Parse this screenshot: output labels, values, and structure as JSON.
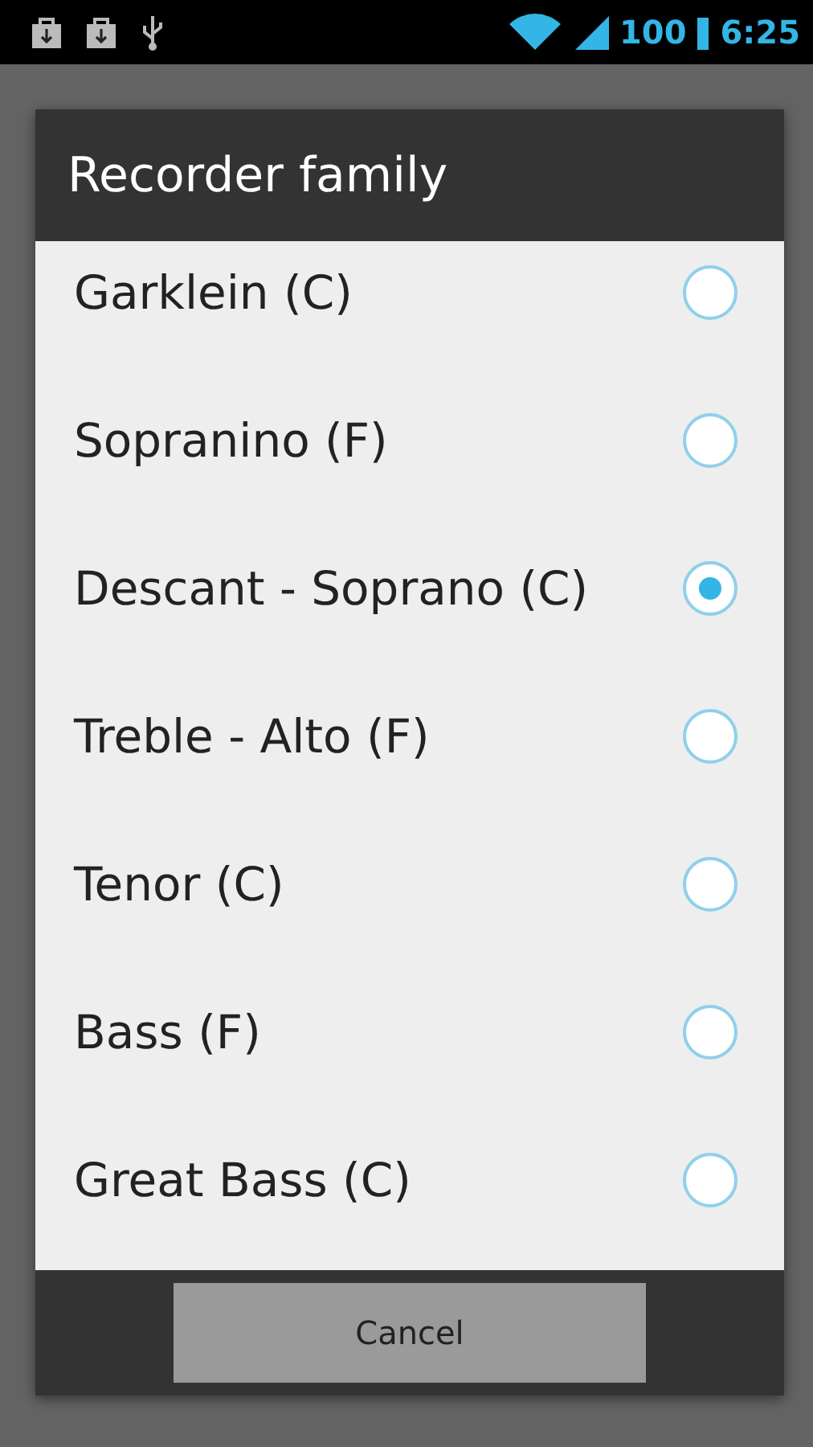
{
  "status_bar": {
    "battery": "100",
    "time": "6:25"
  },
  "dialog": {
    "title": "Recorder family",
    "options": [
      {
        "label": "Garklein (C)",
        "selected": false
      },
      {
        "label": "Sopranino (F)",
        "selected": false
      },
      {
        "label": "Descant - Soprano (C)",
        "selected": true
      },
      {
        "label": "Treble - Alto (F)",
        "selected": false
      },
      {
        "label": "Tenor (C)",
        "selected": false
      },
      {
        "label": "Bass (F)",
        "selected": false
      },
      {
        "label": "Great Bass (C)",
        "selected": false
      }
    ],
    "buttons": [
      "Cancel"
    ]
  }
}
